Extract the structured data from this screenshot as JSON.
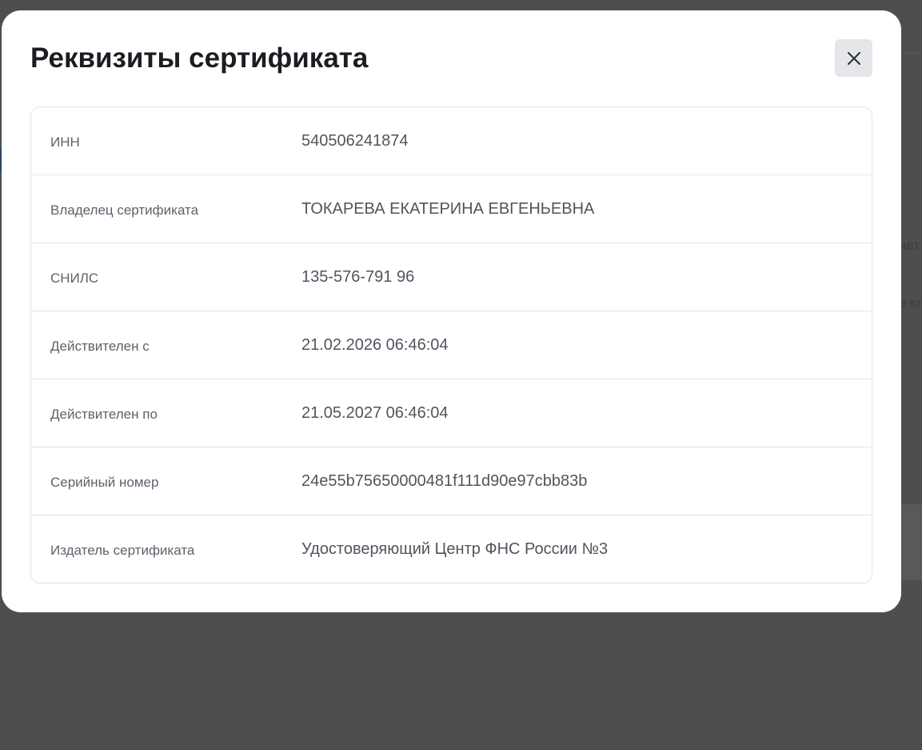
{
  "background": {
    "fragments": [
      "нет",
      "е кл"
    ]
  },
  "modal": {
    "title": "Реквизиты сертификата",
    "close_icon": "close-icon",
    "rows": [
      {
        "label": "ИНН",
        "value": "540506241874"
      },
      {
        "label": "Владелец сертификата",
        "value": "ТОКАРЕВА ЕКАТЕРИНА ЕВГЕНЬЕВНА"
      },
      {
        "label": "СНИЛС",
        "value": "135-576-791 96"
      },
      {
        "label": "Действителен с",
        "value": "21.02.2026 06:46:04"
      },
      {
        "label": "Действителен по",
        "value": "21.05.2027 06:46:04"
      },
      {
        "label": "Серийный номер",
        "value": "24e55b75650000481f111d90e97cbb83b"
      },
      {
        "label": "Издатель сертификата",
        "value": "Удостоверяющий Центр ФНС России №3"
      }
    ]
  },
  "colors": {
    "overlay": "#4d4e50",
    "modal_bg": "#ffffff",
    "close_button_bg": "#e4e6ea",
    "border": "#e2e5ea",
    "title_text": "#1b1d22",
    "label_text": "#5d626b",
    "value_text": "#50555e"
  }
}
